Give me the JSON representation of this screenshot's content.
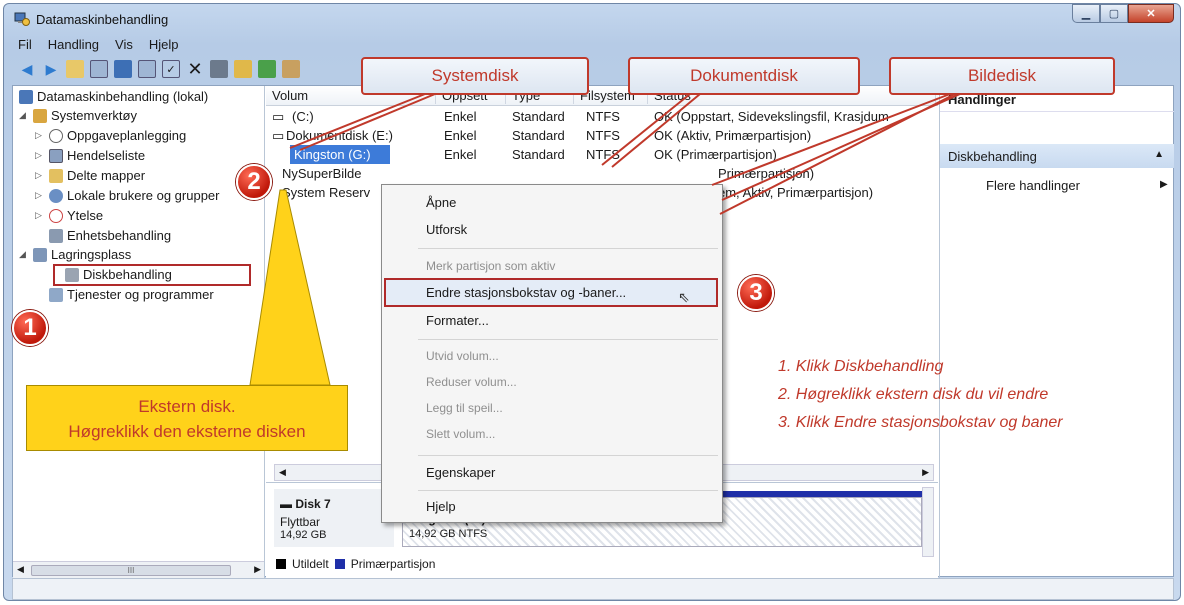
{
  "window": {
    "title": "Datamaskinbehandling"
  },
  "menu": [
    "Fil",
    "Handling",
    "Vis",
    "Hjelp"
  ],
  "tree": {
    "items": [
      {
        "label": "Datamaskinbehandling (lokal)"
      },
      {
        "label": "Systemverktøy"
      },
      {
        "label": "Oppgaveplanlegging"
      },
      {
        "label": "Hendelseliste"
      },
      {
        "label": "Delte mapper"
      },
      {
        "label": "Lokale brukere og grupper"
      },
      {
        "label": "Ytelse"
      },
      {
        "label": "Enhetsbehandling"
      },
      {
        "label": "Lagringsplass"
      },
      {
        "label": "Diskbehandling"
      },
      {
        "label": "Tjenester og programmer"
      }
    ],
    "scroll_label": "III"
  },
  "list": {
    "columns": [
      "Volum",
      "Oppsett",
      "Type",
      "Filsystem",
      "Status"
    ],
    "rows": [
      {
        "volume": "(C:)",
        "layout": "Enkel",
        "type": "Standard",
        "fs": "NTFS",
        "status": "OK (Oppstart, Sidevekslingsfil, Krasjdum"
      },
      {
        "volume": "Dokumentdisk (E:)",
        "layout": "Enkel",
        "type": "Standard",
        "fs": "NTFS",
        "status": "OK (Aktiv, Primærpartisjon)"
      },
      {
        "volume": "Kingston (G:)",
        "layout": "Enkel",
        "type": "Standard",
        "fs": "NTFS",
        "status": "OK (Primærpartisjon)"
      },
      {
        "volume": "NySuperBilde",
        "layout": "",
        "type": "",
        "fs": "",
        "status": "Primærpartisjon)"
      },
      {
        "volume": "System Reserv",
        "layout": "",
        "type": "",
        "fs": "",
        "status": "em, Aktiv, Primærpartisjon)"
      }
    ]
  },
  "disk": {
    "name": "Disk 7",
    "kind": "Flyttbar",
    "size": "14,92 GB",
    "partition_label": "Kingston (G:)",
    "partition_detail": "14,92 GB NTFS"
  },
  "legend": [
    {
      "label": "Utildelt",
      "color": "#000000"
    },
    {
      "label": "Primærpartisjon",
      "color": "#1f2fa8"
    }
  ],
  "actions": {
    "header": "Handlinger",
    "selected": "Diskbehandling",
    "more": "Flere handlinger"
  },
  "context_menu": [
    {
      "label": "Åpne",
      "disabled": false
    },
    {
      "label": "Utforsk",
      "disabled": false
    },
    {
      "label": "Merk partisjon som aktiv",
      "disabled": true
    },
    {
      "label": "Endre stasjonsbokstav og -baner...",
      "disabled": false
    },
    {
      "label": "Formater...",
      "disabled": false
    },
    {
      "label": "Utvid volum...",
      "disabled": true
    },
    {
      "label": "Reduser volum...",
      "disabled": true
    },
    {
      "label": "Legg til speil...",
      "disabled": true
    },
    {
      "label": "Slett volum...",
      "disabled": true
    },
    {
      "label": "Egenskaper",
      "disabled": false
    },
    {
      "label": "Hjelp",
      "disabled": false
    }
  ],
  "callouts": {
    "systemdisk": "Systemdisk",
    "dokumentdisk": "Dokumentdisk",
    "bildedisk": "Bildedisk",
    "external_line1": "Ekstern disk.",
    "external_line2": "Høgreklikk den eksterne disken"
  },
  "badges": [
    "1",
    "2",
    "3"
  ],
  "instructions": [
    "1. Klikk Diskbehandling",
    "2. Høgreklikk ekstern disk du vil endre",
    "3. Klikk Endre stasjonsbokstav og baner"
  ],
  "colors": {
    "annotation_red": "#c0392b",
    "callout_yellow": "#ffd21a",
    "selection_blue": "#3d7bd9"
  }
}
